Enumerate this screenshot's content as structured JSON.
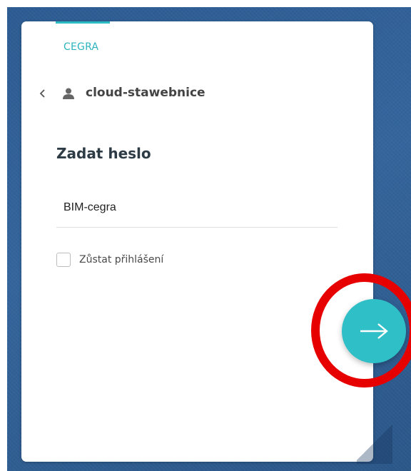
{
  "brand": {
    "name": "CEGRA",
    "accent_color": "#2bbcc3"
  },
  "account": {
    "username": "cloud-stawebnice",
    "icon": "user-icon",
    "back_icon": "chevron-left-icon"
  },
  "form": {
    "heading": "Zadat heslo",
    "password_value": "BIM-cegra",
    "remember_label": "Zůstat přihlášení",
    "remember_checked": false
  },
  "actions": {
    "next_icon": "arrow-right-icon",
    "next_color": "#2fbfc7"
  },
  "annotation": {
    "highlight_color": "#e60000"
  }
}
